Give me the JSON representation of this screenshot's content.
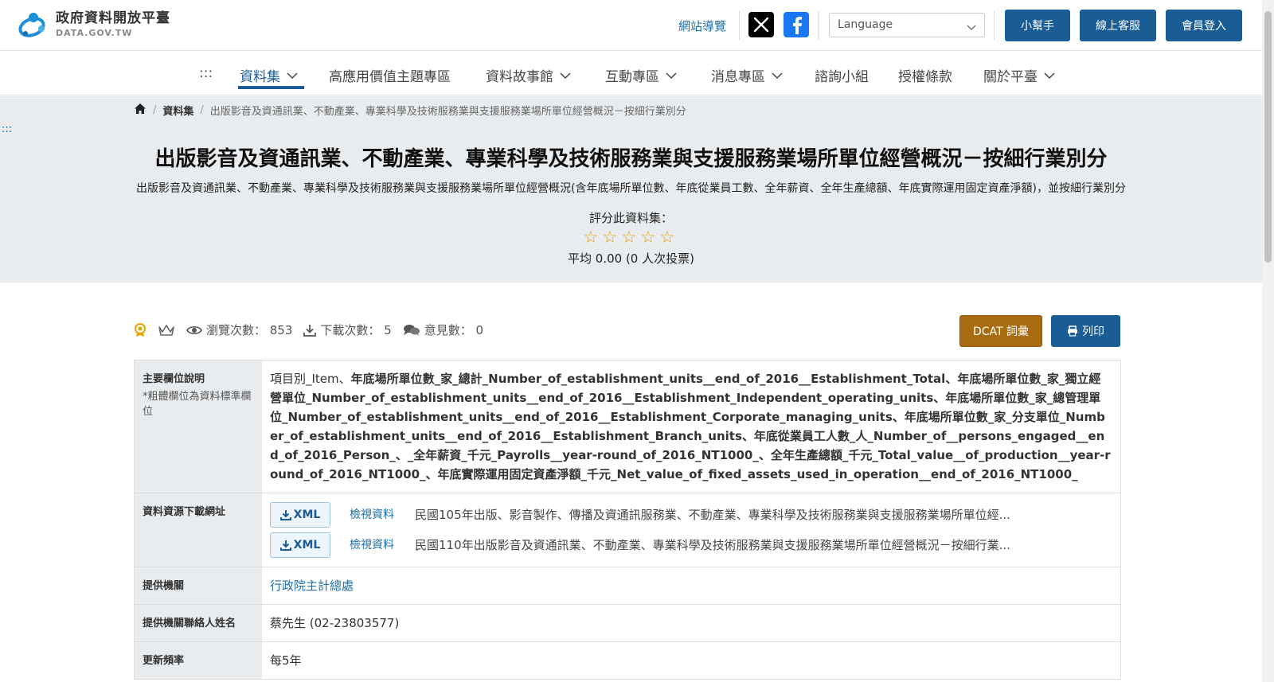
{
  "header": {
    "logo_cn": "政府資料開放平臺",
    "logo_en": "DATA.GOV.TW",
    "sitemap": "網站導覽",
    "language_placeholder": "Language",
    "helper": "小幫手",
    "support": "線上客服",
    "login": "會員登入"
  },
  "nav": {
    "dots": ":::",
    "items": [
      {
        "label": "資料集",
        "dropdown": true
      },
      {
        "label": "高應用價值主題專區",
        "dropdown": false
      },
      {
        "label": "資料故事館",
        "dropdown": true
      },
      {
        "label": "互動專區",
        "dropdown": true
      },
      {
        "label": "消息專區",
        "dropdown": true
      },
      {
        "label": "諮詢小組",
        "dropdown": false
      },
      {
        "label": "授權條款",
        "dropdown": false
      },
      {
        "label": "關於平臺",
        "dropdown": true
      }
    ]
  },
  "breadcrumb": {
    "section": "資料集",
    "current": "出版影音及資通訊業、不動產業、專業科學及技術服務業與支援服務業場所單位經營概況－按細行業別分"
  },
  "side_dots": ":::",
  "dataset": {
    "title": "出版影音及資通訊業、不動產業、專業科學及技術服務業與支援服務業場所單位經營概況－按細行業別分",
    "description": "出版影音及資通訊業、不動產業、專業科學及技術服務業與支援服務業場所單位經營概況(含年底場所單位數、年底從業員工數、全年薪資、全年生產總額、年底實際運用固定資產淨額)，並按細行業別分",
    "rating_label": "評分此資料集：",
    "rating_value": 0,
    "rating_max": 5,
    "rating_avg": "平均 0.00 (0 人次投票)"
  },
  "stats": {
    "views": "瀏覽次數： 853",
    "downloads": "下載次數： 5",
    "comments": "意見數： 0"
  },
  "actions": {
    "dcat": "DCAT 詞彙",
    "print": "列印"
  },
  "table": {
    "main_fields_header": "主要欄位說明",
    "main_fields_note": "*粗體欄位為資料標準欄位",
    "main_fields_item": "項目別_Item、",
    "main_fields_bold": "年底場所單位數_家_總計_Number_of_establishment_units__end_of_2016__Establishment_Total、年底場所單位數_家_獨立經營單位_Number_of_establishment_units__end_of_2016__Establishment_Independent_operating_units、年底場所單位數_家_總管理單位_Number_of_establishment_units__end_of_2016__Establishment_Corporate_managing_units、年底場所單位數_家_分支單位_Number_of_establishment_units__end_of_2016__Establishment_Branch_units、年底從業員工人數_人_Number_of__persons_engaged__end_of_2016_Person_、_全年薪資_千元_Payrolls__year-round_of_2016_NT1000_、全年生產總額_千元_Total_value__of_production__year-round_of_2016_NT1000_、年底實際運用固定資產淨額_千元_Net_value_of_fixed_assets_used_in_operation__end_of_2016_NT1000_",
    "resources_header": "資料資源下載網址",
    "resources": [
      {
        "format": "XML",
        "view": "檢視資料",
        "desc": "民國105年出版、影音製作、傳播及資通訊服務業、不動產業、專業科學及技術服務業與支援服務業場所單位經..."
      },
      {
        "format": "XML",
        "view": "檢視資料",
        "desc": "民國110年出版影音及資通訊業、不動產業、專業科學及技術服務業與支援服務業場所單位經營概況－按細行業..."
      }
    ],
    "agency_header": "提供機關",
    "agency": "行政院主計總處",
    "contact_header": "提供機關聯絡人姓名",
    "contact": "蔡先生 (02-23803577)",
    "frequency_header": "更新頻率",
    "frequency": "每5年"
  }
}
